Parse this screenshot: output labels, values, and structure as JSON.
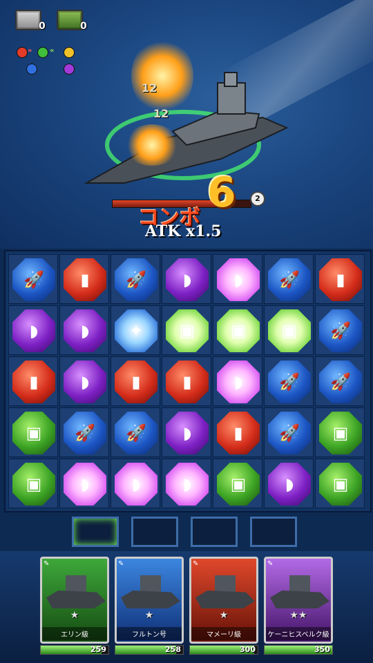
{
  "hud": {
    "resources": [
      {
        "icon": "grey-crate-icon",
        "count": "0"
      },
      {
        "icon": "green-crate-icon",
        "count": "0"
      }
    ],
    "gem_chain": {
      "row1": [
        "red",
        "green",
        "yellow"
      ],
      "row2": [
        "blue",
        "purple"
      ]
    }
  },
  "enemy": {
    "damage_numbers": [
      "12",
      "12"
    ],
    "turn_counter": "2"
  },
  "combo": {
    "label": "コンボ",
    "count": "6",
    "atk_text": "ATK x1.5",
    "progress": 0.78
  },
  "board": {
    "rows": [
      [
        "blue-missile",
        "red-shell",
        "blue-missile",
        "purple-sub",
        "purple-sub-glow",
        "blue-missile",
        "red-shell"
      ],
      [
        "purple-sub",
        "purple-sub",
        "star-gem",
        "green-tank-glow",
        "green-tank-glow",
        "green-tank-glow",
        "blue-missile"
      ],
      [
        "red-shell",
        "purple-sub",
        "red-shell",
        "red-shell",
        "purple-sub-glow",
        "blue-missile",
        "blue-missile"
      ],
      [
        "green-tank",
        "blue-missile",
        "blue-missile",
        "purple-sub",
        "red-shell",
        "blue-missile",
        "green-tank"
      ],
      [
        "green-tank",
        "purple-sub-glow",
        "purple-sub-glow",
        "purple-sub-glow",
        "green-tank",
        "purple-sub",
        "green-tank"
      ]
    ],
    "symbols": {
      "missile": "🚀",
      "shell": "▮",
      "sub": "◗",
      "tank": "▣",
      "star": "✦"
    }
  },
  "slots": [
    "",
    "",
    "",
    ""
  ],
  "fleet": [
    {
      "name": "エリン級",
      "stars": "★",
      "hp": "259",
      "hp_pct": 0.9,
      "color": "green"
    },
    {
      "name": "フルトン号",
      "stars": "★",
      "hp": "258",
      "hp_pct": 0.9,
      "color": "blue"
    },
    {
      "name": "マメーリ級",
      "stars": "★",
      "hp": "300",
      "hp_pct": 0.95,
      "color": "red"
    },
    {
      "name": "ケーニヒスベルク級",
      "stars": "★★",
      "hp": "350",
      "hp_pct": 1.0,
      "color": "purple"
    }
  ]
}
